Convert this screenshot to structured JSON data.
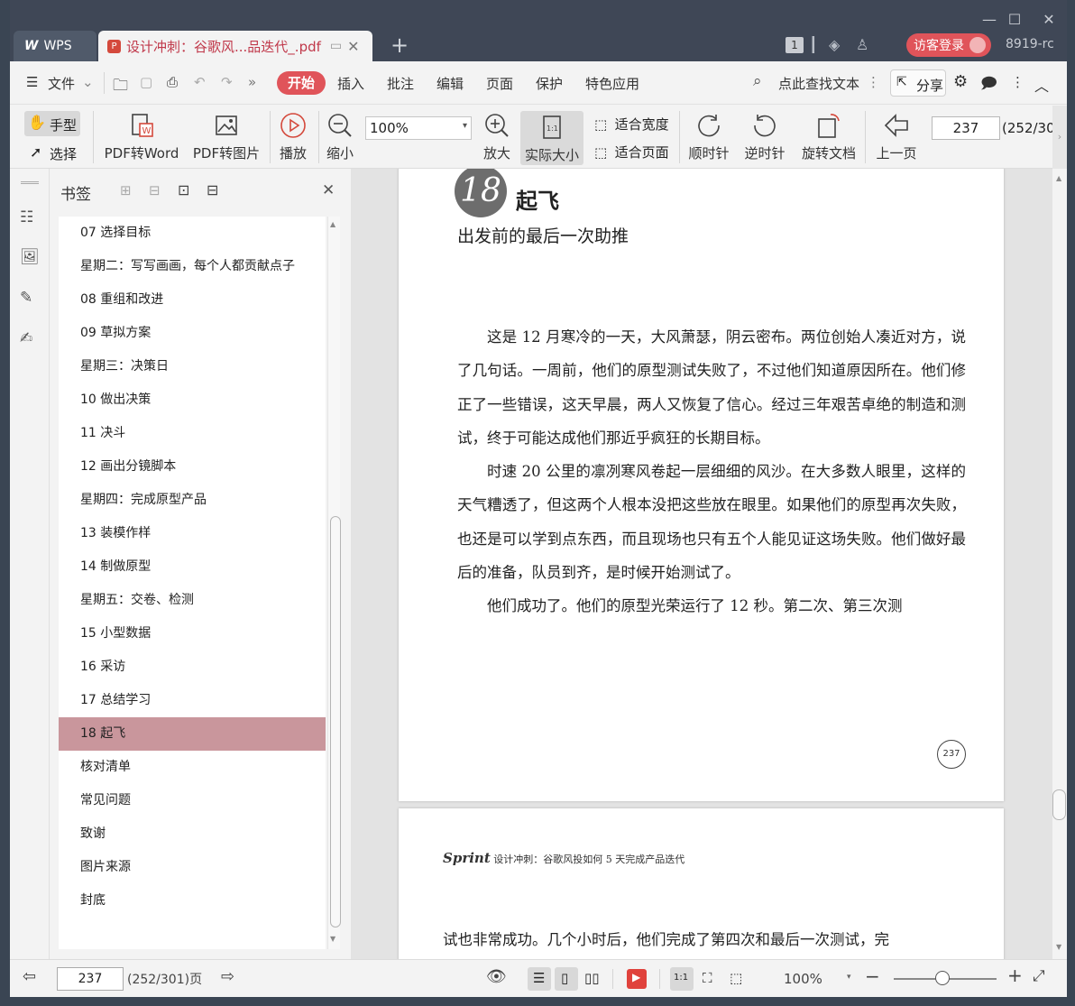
{
  "titlebar": {
    "app_tab": "WPS",
    "doc_tab": "设计冲刺：谷歌风...品迭代_.pdf",
    "new_tab": "+",
    "badge": "1",
    "login": "访客登录",
    "version": "8919-rc"
  },
  "menu": {
    "file": "文件",
    "items": [
      "开始",
      "插入",
      "批注",
      "编辑",
      "页面",
      "保护",
      "特色应用"
    ],
    "search": "点此查找文本",
    "share": "分享"
  },
  "ribbon": {
    "hand": "手型",
    "select": "选择",
    "pdf_to_word": "PDF转Word",
    "pdf_to_image": "PDF转图片",
    "play": "播放",
    "zoom_out": "缩小",
    "zoom_value": "100%",
    "zoom_in": "放大",
    "actual_size": "实际大小",
    "fit_width": "适合宽度",
    "fit_page": "适合页面",
    "clockwise": "顺时针",
    "counterclockwise": "逆时针",
    "rotate_doc": "旋转文档",
    "prev_page": "上一页",
    "page_input": "237",
    "page_total": "(252/30"
  },
  "bookmarks": {
    "title": "书签",
    "items": [
      "07  选择目标",
      "星期二：写写画画，每个人都贡献点子",
      "08  重组和改进",
      "09  草拟方案",
      "星期三：决策日",
      "10  做出决策",
      "11  决斗",
      "12  画出分镜脚本",
      "星期四：完成原型产品",
      "13  装模作样",
      "14  制做原型",
      "星期五：交卷、检测",
      "15  小型数据",
      "16  采访",
      "17  总结学习",
      "18  起飞",
      "核对清单",
      "常见问题",
      "致谢",
      "图片来源",
      "封底"
    ],
    "selected_index": 15
  },
  "page1": {
    "chapter_number": "18",
    "chapter_title": "起飞",
    "subtitle": "出发前的最后一次助推",
    "paragraphs": [
      "这是 12 月寒冷的一天，大风萧瑟，阴云密布。两位创始人凑近对方，说了几句话。一周前，他们的原型测试失败了，不过他们知道原因所在。他们修正了一些错误，这天早晨，两人又恢复了信心。经过三年艰苦卓绝的制造和测试，终于可能达成他们那近乎疯狂的长期目标。",
      "时速 20 公里的凛冽寒风卷起一层细细的风沙。在大多数人眼里，这样的天气糟透了，但这两个人根本没把这些放在眼里。如果他们的原型再次失败，也还是可以学到点东西，而且现场也只有五个人能见证这场失败。他们做好最后的准备，队员到齐，是时候开始测试了。",
      "他们成功了。他们的原型光荣运行了 12 秒。第二次、第三次测"
    ],
    "page_number": "237"
  },
  "page2": {
    "running_head_brand": "Sprint",
    "running_head_text": "设计冲刺：谷歌风投如何 5 天完成产品迭代",
    "first_line": "试也非常成功。几个小时后，他们完成了第四次和最后一次测试，完"
  },
  "statusbar": {
    "page_input": "237",
    "page_info": "(252/301)页",
    "zoom": "100%",
    "zoom_level_percent": 100
  },
  "colors": {
    "accent": "#e0545a",
    "selected_bookmark": "#c9969c",
    "titlebar": "#3f4756"
  }
}
